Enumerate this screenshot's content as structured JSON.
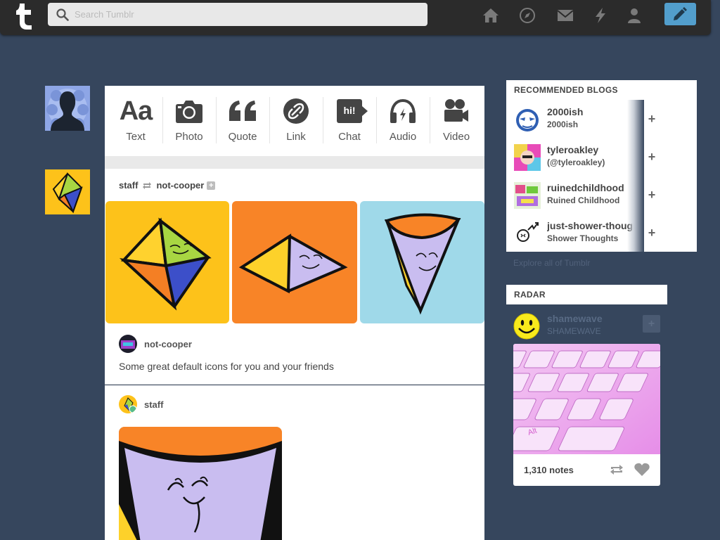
{
  "topbar": {
    "search_placeholder": "Search Tumblr",
    "nav": [
      "home-icon",
      "explore-icon",
      "inbox-icon",
      "activity-icon",
      "account-icon"
    ],
    "compose_icon": "pencil-icon",
    "accent": "#529ecc"
  },
  "post_types": [
    {
      "label": "Text",
      "icon": "text-icon"
    },
    {
      "label": "Photo",
      "icon": "camera-icon"
    },
    {
      "label": "Quote",
      "icon": "quote-icon"
    },
    {
      "label": "Link",
      "icon": "link-icon"
    },
    {
      "label": "Chat",
      "icon": "chat-icon"
    },
    {
      "label": "Audio",
      "icon": "headphones-icon"
    },
    {
      "label": "Video",
      "icon": "video-camera-icon"
    }
  ],
  "chat_glyph": "hi!",
  "text_glyph": "Aa",
  "post1": {
    "reblogger": "staff",
    "source": "not-cooper",
    "caption_user": "not-cooper",
    "caption": "Some great default icons for you and your friends"
  },
  "post2": {
    "user": "staff"
  },
  "recommended": {
    "heading": "RECOMMENDED BLOGS",
    "blogs": [
      {
        "name": "2000ish",
        "title": "2000ish"
      },
      {
        "name": "tyleroakley",
        "title": "(@tyleroakley)"
      },
      {
        "name": "ruinedchildhood",
        "title": "Ruined Childhood"
      },
      {
        "name": "just-shower-thoughts",
        "title": "Shower Thoughts"
      }
    ],
    "explore": "Explore all of Tumblr"
  },
  "radar": {
    "heading": "RADAR",
    "name": "shamewave",
    "title": "SHAMEWAVE",
    "notes": "1,310 notes",
    "key_label": "Alt"
  }
}
